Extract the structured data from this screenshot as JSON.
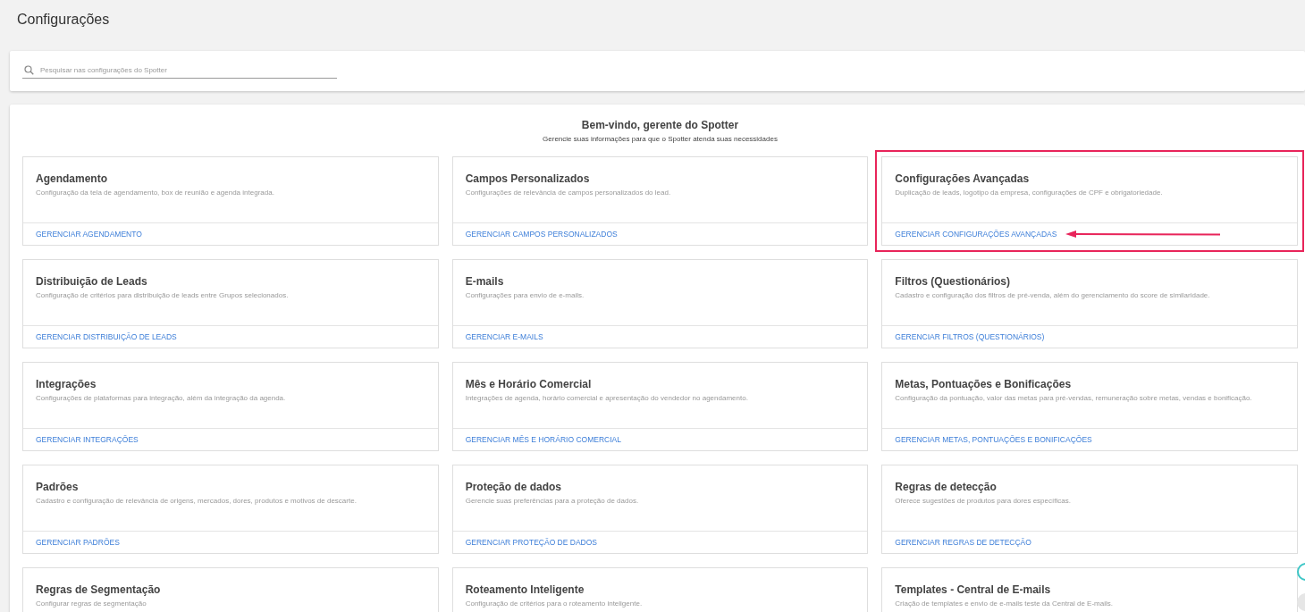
{
  "page_title": "Configurações",
  "search": {
    "placeholder": "Pesquisar nas configurações do Spotter"
  },
  "welcome": {
    "title": "Bem-vindo, gerente do Spotter",
    "subtitle": "Gerencie suas informações para que o Spotter atenda suas necessidades"
  },
  "cards": [
    {
      "title": "Agendamento",
      "description": "Configuração da tela de agendamento, box de reunião e agenda integrada.",
      "link": "GERENCIAR AGENDAMENTO",
      "highlighted": false
    },
    {
      "title": "Campos Personalizados",
      "description": "Configurações de relevância de campos personalizados do lead.",
      "link": "GERENCIAR CAMPOS PERSONALIZADOS",
      "highlighted": false
    },
    {
      "title": "Configurações Avançadas",
      "description": "Duplicação de leads, logotipo da empresa, configurações de CPF e obrigatoriedade.",
      "link": "GERENCIAR CONFIGURAÇÕES AVANÇADAS",
      "highlighted": true
    },
    {
      "title": "Distribuição de Leads",
      "description": "Configuração de critérios para distribuição de leads entre Grupos selecionados.",
      "link": "GERENCIAR DISTRIBUIÇÃO DE LEADS",
      "highlighted": false
    },
    {
      "title": "E-mails",
      "description": "Configurações para envio de e-mails.",
      "link": "GERENCIAR E-MAILS",
      "highlighted": false
    },
    {
      "title": "Filtros (Questionários)",
      "description": "Cadastro e configuração dos filtros de pré-venda, além do gerenciamento do score de similaridade.",
      "link": "GERENCIAR FILTROS (QUESTIONÁRIOS)",
      "highlighted": false
    },
    {
      "title": "Integrações",
      "description": "Configurações de plataformas para integração, além da integração da agenda.",
      "link": "GERENCIAR INTEGRAÇÕES",
      "highlighted": false
    },
    {
      "title": "Mês e Horário Comercial",
      "description": "Integrações de agenda, horário comercial e apresentação do vendedor no agendamento.",
      "link": "GERENCIAR MÊS E HORÁRIO COMERCIAL",
      "highlighted": false
    },
    {
      "title": "Metas, Pontuações e Bonificações",
      "description": "Configuração da pontuação, valor das metas para pré-vendas, remuneração sobre metas, vendas e bonificação.",
      "link": "GERENCIAR METAS, PONTUAÇÕES E BONIFICAÇÕES",
      "highlighted": false
    },
    {
      "title": "Padrões",
      "description": "Cadastro e configuração de relevância de origens, mercados, dores, produtos e motivos de descarte.",
      "link": "GERENCIAR PADRÕES",
      "highlighted": false
    },
    {
      "title": "Proteção de dados",
      "description": "Gerencie suas preferências para a proteção de dados.",
      "link": "GERENCIAR PROTEÇÃO DE DADOS",
      "highlighted": false
    },
    {
      "title": "Regras de detecção",
      "description": "Oferece sugestões de produtos para dores específicas.",
      "link": "GERENCIAR REGRAS DE DETECÇÃO",
      "highlighted": false
    },
    {
      "title": "Regras de Segmentação",
      "description": "Configurar regras de segmentação"
    },
    {
      "title": "Roteamento Inteligente",
      "description": "Configuração de critérios para o roteamento inteligente."
    },
    {
      "title": "Templates - Central de E-mails",
      "description": "Criação de templates e envio de e-mails teste da Central de E-mails."
    }
  ]
}
